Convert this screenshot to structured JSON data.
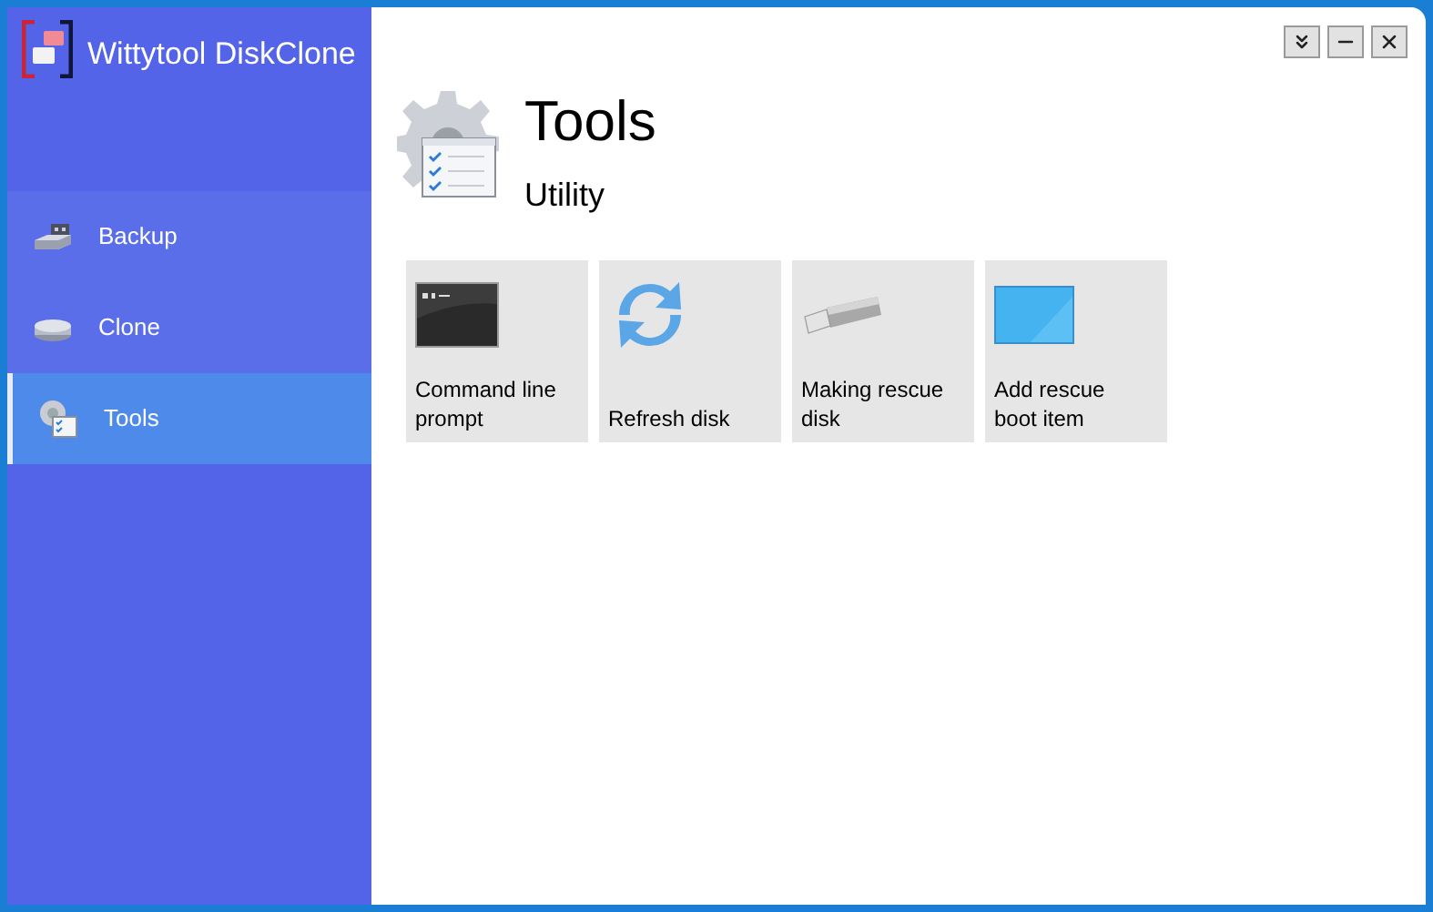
{
  "app_title": "Wittytool DiskClone",
  "nav": [
    {
      "label": "Backup",
      "kind": "backup",
      "selected": false
    },
    {
      "label": "Clone",
      "kind": "clone",
      "selected": false
    },
    {
      "label": "Tools",
      "kind": "tools",
      "selected": true
    }
  ],
  "page": {
    "title": "Tools",
    "subtitle": "Utility"
  },
  "tools": [
    {
      "label": "Command line prompt",
      "kind": "cmd"
    },
    {
      "label": "Refresh disk",
      "kind": "refresh"
    },
    {
      "label": "Making rescue disk",
      "kind": "usb"
    },
    {
      "label": "Add rescue boot item",
      "kind": "screen"
    }
  ]
}
